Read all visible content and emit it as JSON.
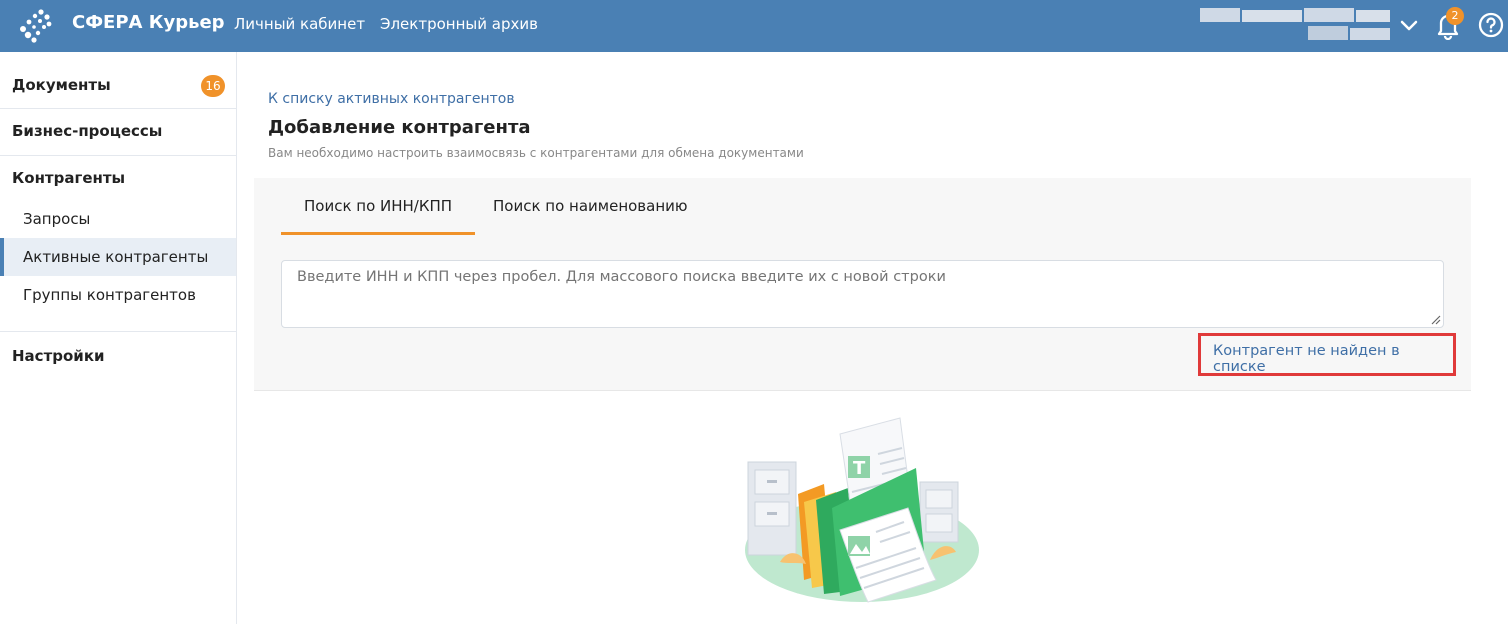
{
  "header": {
    "brand": "СФЕРА Курьер",
    "nav": [
      "Личный кабинет",
      "Электронный архив"
    ],
    "notifications_count": "2"
  },
  "sidebar": {
    "documents_label": "Документы",
    "documents_count": "16",
    "business_processes_label": "Бизнес-процессы",
    "counterparties_label": "Контрагенты",
    "sub_items": [
      "Запросы",
      "Активные контрагенты",
      "Группы контрагентов"
    ],
    "active_sub_item": "Активные контрагенты",
    "settings_label": "Настройки"
  },
  "main": {
    "back_link": "К списку активных контрагентов",
    "title": "Добавление контрагента",
    "subtitle": "Вам необходимо настроить взаимосвязь с контрагентами для обмена документами",
    "tabs": [
      "Поиск по ИНН/КПП",
      "Поиск по наименованию"
    ],
    "active_tab": "Поиск по ИНН/КПП",
    "search_placeholder": "Введите ИНН и КПП через пробел. Для массового поиска введите их с новой строки",
    "not_found_link": "Контрагент не найден в списке"
  },
  "colors": {
    "header_bg": "#4a80b4",
    "accent_orange": "#f0922a",
    "link_blue": "#3f6fa6",
    "highlight_red": "#e03a3a"
  }
}
